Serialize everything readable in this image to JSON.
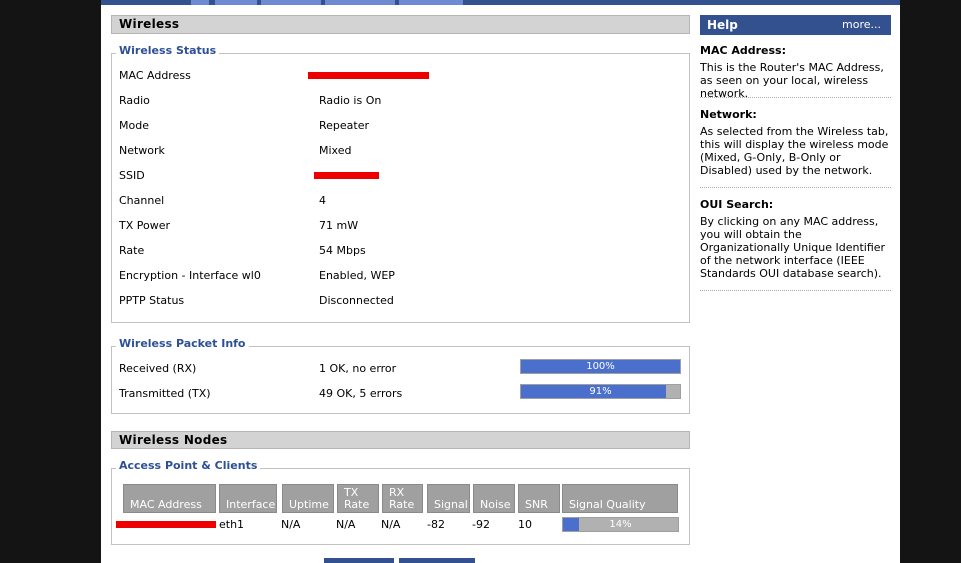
{
  "sections": {
    "wireless": "Wireless",
    "wireless_nodes": "Wireless Nodes"
  },
  "status": {
    "legend": "Wireless Status",
    "rows": [
      {
        "label": "MAC Address",
        "value": ""
      },
      {
        "label": "Radio",
        "value": "Radio is On"
      },
      {
        "label": "Mode",
        "value": "Repeater"
      },
      {
        "label": "Network",
        "value": "Mixed"
      },
      {
        "label": "SSID",
        "value": ""
      },
      {
        "label": "Channel",
        "value": "4"
      },
      {
        "label": "TX Power",
        "value": "71 mW"
      },
      {
        "label": "Rate",
        "value": "54 Mbps"
      },
      {
        "label": "Encryption - Interface wl0",
        "value": "Enabled, WEP"
      },
      {
        "label": "PPTP Status",
        "value": "Disconnected"
      }
    ]
  },
  "packet": {
    "legend": "Wireless Packet Info",
    "rx": {
      "label": "Received (RX)",
      "value": "1 OK, no error",
      "meter_text": "100%",
      "meter_fraction": 1.0
    },
    "tx": {
      "label": "Transmitted (TX)",
      "value": "49 OK, 5 errors",
      "meter_text": "91%",
      "meter_fraction": 0.91
    }
  },
  "nodes": {
    "legend": "Access Point & Clients",
    "headers": [
      "MAC Address",
      "Interface",
      "Uptime",
      "TX\nRate",
      "RX\nRate",
      "Signal",
      "Noise",
      "SNR",
      "Signal Quality"
    ],
    "row": {
      "mac": "",
      "interface": "eth1",
      "uptime": "N/A",
      "tx_rate": "N/A",
      "rx_rate": "N/A",
      "signal": "-82",
      "noise": "-92",
      "snr": "10",
      "quality_text": "14%",
      "quality_fraction": 0.14
    }
  },
  "help": {
    "title": "Help",
    "more": "more...",
    "items": [
      {
        "heading": "MAC Address:",
        "text": "This is the Router's MAC Address, as seen on your local, wireless network."
      },
      {
        "heading": "Network:",
        "text": "As selected from the Wireless tab, this will display the wireless mode (Mixed, G-Only, B-Only or Disabled) used by the network."
      },
      {
        "heading": "OUI Search:",
        "text": "By clicking on any MAC address, you will obtain the Organizationally Unique Identifier of the network interface (IEEE Standards OUI database search)."
      }
    ]
  },
  "colors": {
    "accent": "#33518e",
    "meter_fill": "#4a6fcd",
    "legend_text": "#2d5096",
    "redaction": "#ee0000"
  }
}
